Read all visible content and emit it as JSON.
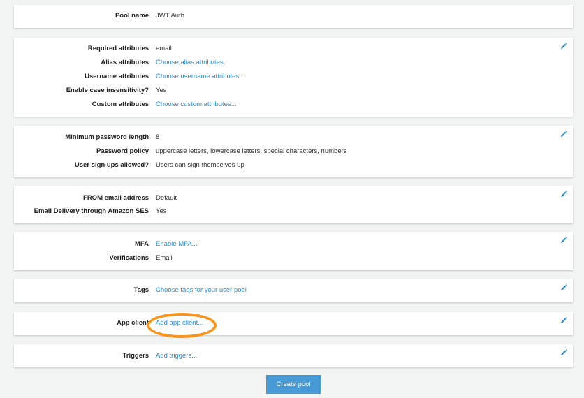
{
  "sections": [
    {
      "editable": false,
      "rows": [
        {
          "label": "Pool name",
          "value": "JWT Auth",
          "link": false
        }
      ]
    },
    {
      "editable": true,
      "rows": [
        {
          "label": "Required attributes",
          "value": "email",
          "link": false
        },
        {
          "label": "Alias attributes",
          "value": "Choose alias attributes...",
          "link": true
        },
        {
          "label": "Username attributes",
          "value": "Choose username attributes...",
          "link": true
        },
        {
          "label": "Enable case insensitivity?",
          "value": "Yes",
          "link": false
        },
        {
          "label": "Custom attributes",
          "value": "Choose custom attributes...",
          "link": true
        }
      ]
    },
    {
      "editable": true,
      "rows": [
        {
          "label": "Minimum password length",
          "value": "8",
          "link": false
        },
        {
          "label": "Password policy",
          "value": "uppercase letters, lowercase letters, special characters, numbers",
          "link": false
        },
        {
          "label": "User sign ups allowed?",
          "value": "Users can sign themselves up",
          "link": false
        }
      ]
    },
    {
      "editable": true,
      "rows": [
        {
          "label": "FROM email address",
          "value": "Default",
          "link": false
        },
        {
          "label": "Email Delivery through Amazon SES",
          "value": "Yes",
          "link": false
        }
      ]
    },
    {
      "editable": true,
      "rows": [
        {
          "label": "MFA",
          "value": "Enable MFA...",
          "link": true
        },
        {
          "label": "Verifications",
          "value": "Email",
          "link": false
        }
      ]
    },
    {
      "editable": true,
      "rows": [
        {
          "label": "Tags",
          "value": "Choose tags for your user pool",
          "link": true
        }
      ]
    },
    {
      "editable": true,
      "rows": [
        {
          "label": "App client",
          "value": "Add app client...",
          "link": true
        }
      ]
    },
    {
      "editable": true,
      "rows": [
        {
          "label": "Triggers",
          "value": "Add triggers...",
          "link": true
        }
      ]
    }
  ],
  "create_button": "Create pool",
  "colors": {
    "link": "#2a8dd4",
    "button": "#479ad6",
    "highlight": "#f7941d"
  }
}
